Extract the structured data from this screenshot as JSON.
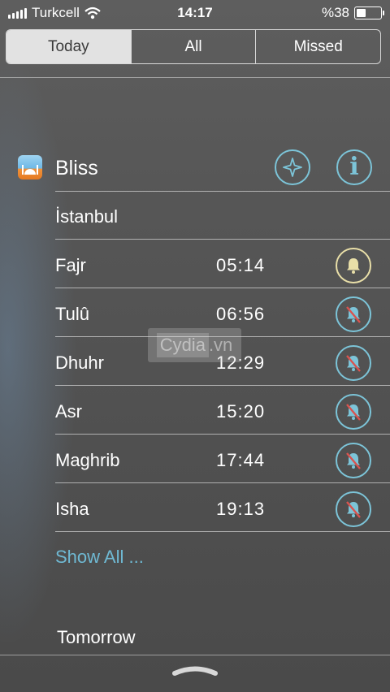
{
  "status_bar": {
    "carrier": "Turkcell",
    "time": "14:17",
    "battery": "%38",
    "battery_level": 0.38
  },
  "segments": [
    {
      "label": "Today",
      "active": true
    },
    {
      "label": "All",
      "active": false
    },
    {
      "label": "Missed",
      "active": false
    }
  ],
  "widget": {
    "title": "Bliss",
    "city": "İstanbul",
    "prayers": [
      {
        "name": "Fajr",
        "time": "05:14",
        "alarm": "on"
      },
      {
        "name": "Tulû",
        "time": "06:56",
        "alarm": "off"
      },
      {
        "name": "Dhuhr",
        "time": "12:29",
        "alarm": "off"
      },
      {
        "name": "Asr",
        "time": "15:20",
        "alarm": "off"
      },
      {
        "name": "Maghrib",
        "time": "17:44",
        "alarm": "off"
      },
      {
        "name": "Isha",
        "time": "19:13",
        "alarm": "off"
      }
    ],
    "show_all": "Show All ..."
  },
  "tomorrow_label": "Tomorrow",
  "watermark": {
    "main": "Cydia",
    "suffix": ".vn"
  },
  "colors": {
    "accent": "#7cc4d8",
    "link": "#6fb9d3",
    "bell_on": "#e9dfa8",
    "bell_off_slash": "#d9534f"
  }
}
